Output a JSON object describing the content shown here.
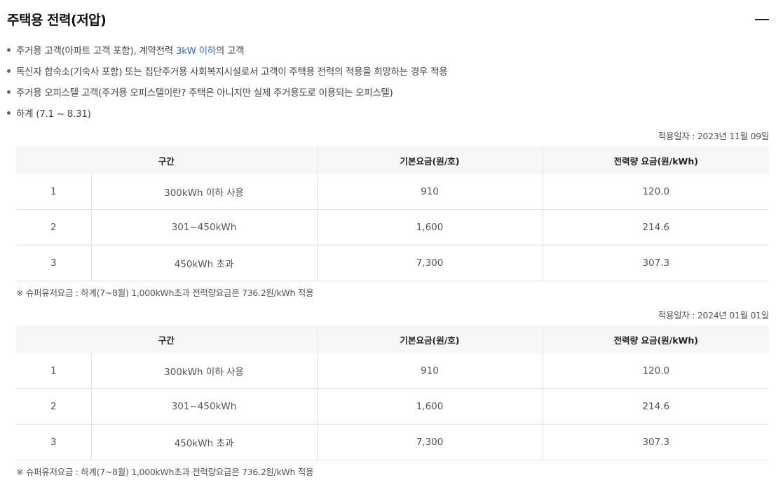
{
  "section": {
    "title": "주택용 전력(저압)",
    "collapse_label": "—"
  },
  "bullets": [
    {
      "pre": "주거용 고객(아파트 고객 포함), 계약전력 ",
      "highlight": "3kW 이하",
      "post": "의 고객"
    },
    {
      "pre": "독신자 합숙소(기숙사 포함) 또는 집단주거용 사회복지시설로서 고객이 주택용 전력의 적용을 희망하는 경우 적용",
      "highlight": "",
      "post": ""
    },
    {
      "pre": "주거용 오피스텔 고객(주거용 오피스텔이란? 주택은 아니지만 실제 주거용도로 이용되는 오피스텔)",
      "highlight": "",
      "post": ""
    },
    {
      "pre": "하계 (7.1 ~ 8.31)",
      "highlight": "",
      "post": ""
    }
  ],
  "tables": [
    {
      "date": "적용일자 : 2023년 11월 09일",
      "headers": [
        "구간",
        "기본요금(원/호)",
        "전력량 요금(원/kWh)"
      ],
      "rows": [
        {
          "no": "1",
          "range": "300kWh 이하 사용",
          "base": "910",
          "energy": "120.0"
        },
        {
          "no": "2",
          "range": "301~450kWh",
          "base": "1,600",
          "energy": "214.6"
        },
        {
          "no": "3",
          "range": "450kWh 초과",
          "base": "7,300",
          "energy": "307.3"
        }
      ],
      "note": "※ 슈퍼유저요금 : 하계(7~8월) 1,000kWh초과 전력량요금은 736.2원/kWh 적용"
    },
    {
      "date": "적용일자 : 2024년 01월 01일",
      "headers": [
        "구간",
        "기본요금(원/호)",
        "전력량 요금(원/kWh)"
      ],
      "rows": [
        {
          "no": "1",
          "range": "300kWh 이하 사용",
          "base": "910",
          "energy": "120.0"
        },
        {
          "no": "2",
          "range": "301~450kWh",
          "base": "1,600",
          "energy": "214.6"
        },
        {
          "no": "3",
          "range": "450kWh 초과",
          "base": "7,300",
          "energy": "307.3"
        }
      ],
      "note": "※ 슈퍼유저요금 : 하계(7~8월) 1,000kWh초과 전력량요금은 736.2원/kWh 적용"
    }
  ]
}
